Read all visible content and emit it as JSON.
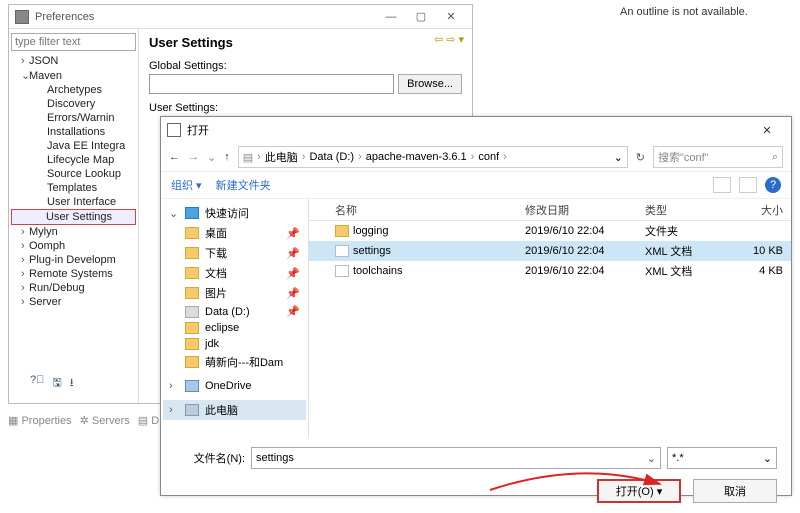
{
  "outline": {
    "message": "An outline is not available."
  },
  "preferences": {
    "title": "Preferences",
    "filter_placeholder": "type filter text",
    "heading": "User Settings",
    "global_label": "Global Settings:",
    "user_label": "User Settings:",
    "browse": "Browse...",
    "tree": [
      {
        "label": "JSON",
        "lvl": 1,
        "arrow": "›"
      },
      {
        "label": "Maven",
        "lvl": 1,
        "arrow": "⌄"
      },
      {
        "label": "Archetypes",
        "lvl": 2,
        "arrow": ""
      },
      {
        "label": "Discovery",
        "lvl": 2,
        "arrow": ""
      },
      {
        "label": "Errors/Warnin",
        "lvl": 2,
        "arrow": ""
      },
      {
        "label": "Installations",
        "lvl": 2,
        "arrow": ""
      },
      {
        "label": "Java EE Integra",
        "lvl": 2,
        "arrow": ""
      },
      {
        "label": "Lifecycle Map",
        "lvl": 2,
        "arrow": ""
      },
      {
        "label": "Source Lookup",
        "lvl": 2,
        "arrow": ""
      },
      {
        "label": "Templates",
        "lvl": 2,
        "arrow": ""
      },
      {
        "label": "User Interface",
        "lvl": 2,
        "arrow": ""
      },
      {
        "label": "User Settings",
        "lvl": 2,
        "arrow": "",
        "selected": true
      },
      {
        "label": "Mylyn",
        "lvl": 1,
        "arrow": "›"
      },
      {
        "label": "Oomph",
        "lvl": 1,
        "arrow": "›"
      },
      {
        "label": "Plug-in Developm",
        "lvl": 1,
        "arrow": "›"
      },
      {
        "label": "Remote Systems",
        "lvl": 1,
        "arrow": "›"
      },
      {
        "label": "Run/Debug",
        "lvl": 1,
        "arrow": "›"
      },
      {
        "label": "Server",
        "lvl": 1,
        "arrow": "›"
      }
    ]
  },
  "tabs": {
    "properties": "Properties",
    "servers": "Servers",
    "data": "D"
  },
  "dialog": {
    "title": "打开",
    "nav_back": "←",
    "nav_fwd": "→",
    "nav_up": "↑",
    "crumbs": [
      "此电脑",
      "Data (D:)",
      "apache-maven-3.6.1",
      "conf"
    ],
    "search_placeholder": "搜索\"conf\"",
    "toolbar": {
      "organize": "组织",
      "newfolder": "新建文件夹"
    },
    "cols": {
      "name": "名称",
      "date": "修改日期",
      "type": "类型",
      "size": "大小"
    },
    "side": [
      {
        "label": "快速访问",
        "cls": "quick",
        "arrow": "⌄"
      },
      {
        "label": "桌面",
        "cls": "",
        "pin": true
      },
      {
        "label": "下载",
        "cls": "",
        "pin": true
      },
      {
        "label": "文档",
        "cls": "",
        "pin": true
      },
      {
        "label": "图片",
        "cls": "",
        "pin": true
      },
      {
        "label": "Data (D:)",
        "cls": "drive",
        "pin": true
      },
      {
        "label": "eclipse",
        "cls": ""
      },
      {
        "label": "jdk",
        "cls": ""
      },
      {
        "label": "萌新向---和Dam",
        "cls": ""
      },
      {
        "label": "OneDrive",
        "cls": "onedrive",
        "arrow": "›",
        "gap": true
      },
      {
        "label": "此电脑",
        "cls": "pc",
        "arrow": "›",
        "selected": true,
        "gap": true
      }
    ],
    "files": [
      {
        "name": "logging",
        "date": "2019/6/10 22:04",
        "type": "文件夹",
        "size": "",
        "ico": "folder"
      },
      {
        "name": "settings",
        "date": "2019/6/10 22:04",
        "type": "XML 文档",
        "size": "10 KB",
        "ico": "doc",
        "selected": true
      },
      {
        "name": "toolchains",
        "date": "2019/6/10 22:04",
        "type": "XML 文档",
        "size": "4 KB",
        "ico": "doc"
      }
    ],
    "filename_label": "文件名(N):",
    "filename_value": "settings",
    "filetype": "*.*",
    "open": "打开(O)",
    "cancel": "取消"
  }
}
